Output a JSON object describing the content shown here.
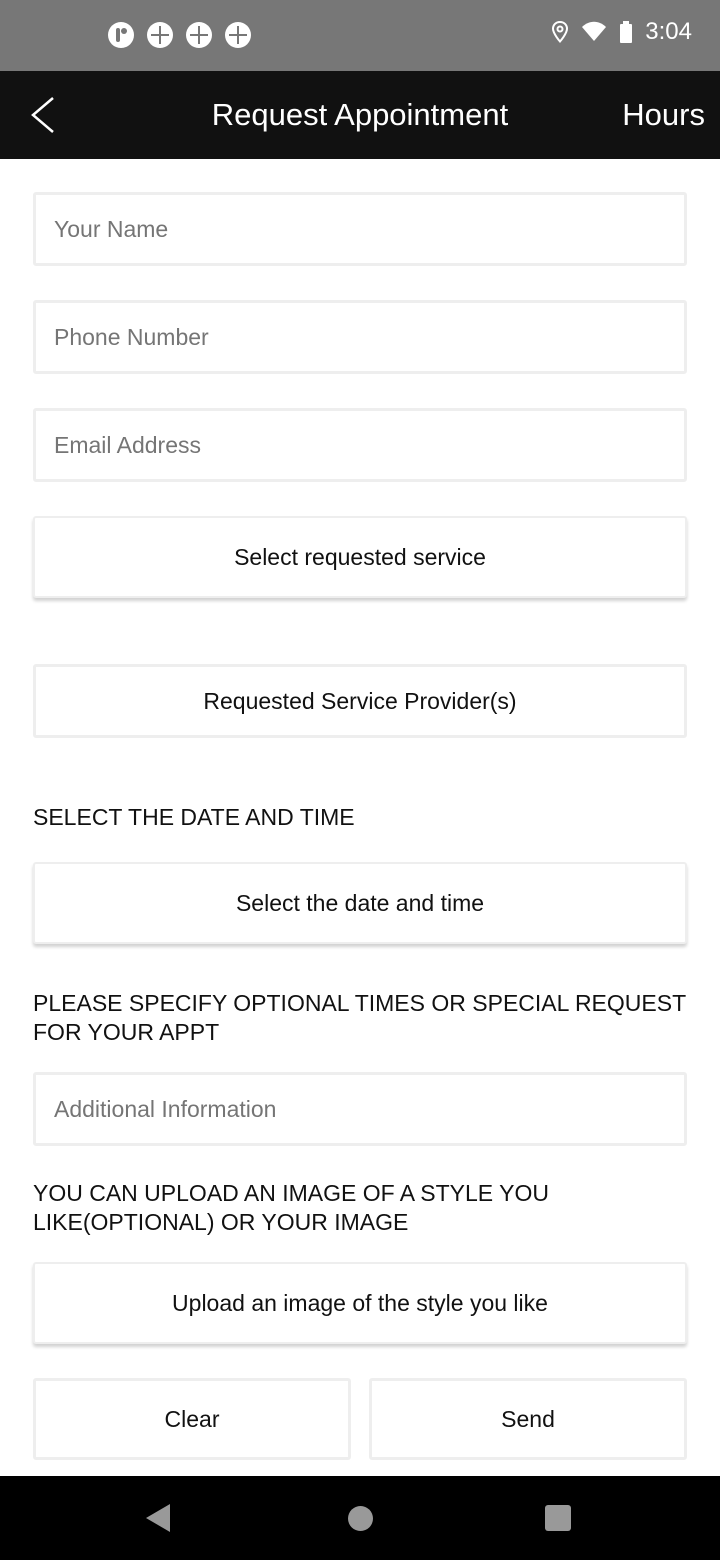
{
  "status_bar": {
    "time": "3:04",
    "notification_icons": [
      "app-notification-icon",
      "clover-notification-icon",
      "clover-notification-icon",
      "clover-notification-icon"
    ],
    "system_icons": [
      "location-icon",
      "wifi-icon",
      "battery-icon"
    ]
  },
  "app_bar": {
    "title": "Request Appointment",
    "right_action": "Hours"
  },
  "form": {
    "name_placeholder": "Your Name",
    "phone_placeholder": "Phone Number",
    "email_placeholder": "Email Address",
    "select_service_label": "Select requested service",
    "service_provider_label": "Requested Service Provider(s)",
    "date_section_label": "SELECT THE DATE AND TIME",
    "date_button_label": "Select the date and time",
    "special_request_label": "PLEASE SPECIFY OPTIONAL TIMES OR SPECIAL REQUEST FOR YOUR APPT",
    "additional_info_placeholder": "Additional Information",
    "upload_section_label": "YOU CAN UPLOAD AN IMAGE OF A STYLE YOU LIKE(OPTIONAL) OR YOUR IMAGE",
    "upload_button_label": "Upload an image of the style you like",
    "clear_label": "Clear",
    "send_label": "Send"
  },
  "colors": {
    "status_bar": "#777777",
    "app_bar": "#111111",
    "border": "#eeeeee",
    "nav_bar": "#000000"
  }
}
